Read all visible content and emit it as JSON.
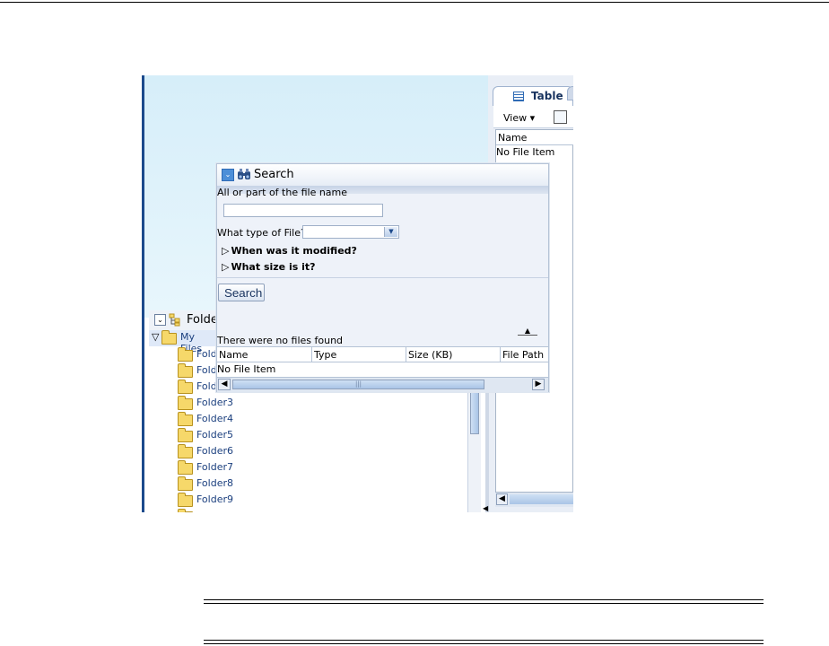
{
  "right_panel": {
    "tab_label": "Table",
    "view_menu": "View",
    "column_name": "Name",
    "empty_text": "No File Item"
  },
  "folders": {
    "title": "Folde",
    "root": "My Files",
    "items": [
      "Folde",
      "Folde",
      "Folde",
      "Folder3",
      "Folder4",
      "Folder5",
      "Folder6",
      "Folder7",
      "Folder8",
      "Folder9"
    ]
  },
  "search": {
    "title": "Search",
    "name_label": "All or part of the file name",
    "name_value": "",
    "type_label": "What type of File?",
    "type_value": "",
    "modified_label": "When was it modified?",
    "size_label": "What size is it?",
    "search_button": "Search",
    "results_message": "There were no files found",
    "columns": [
      "Name",
      "Type",
      "Size (KB)",
      "File Path"
    ],
    "empty_row": "No File Item"
  }
}
